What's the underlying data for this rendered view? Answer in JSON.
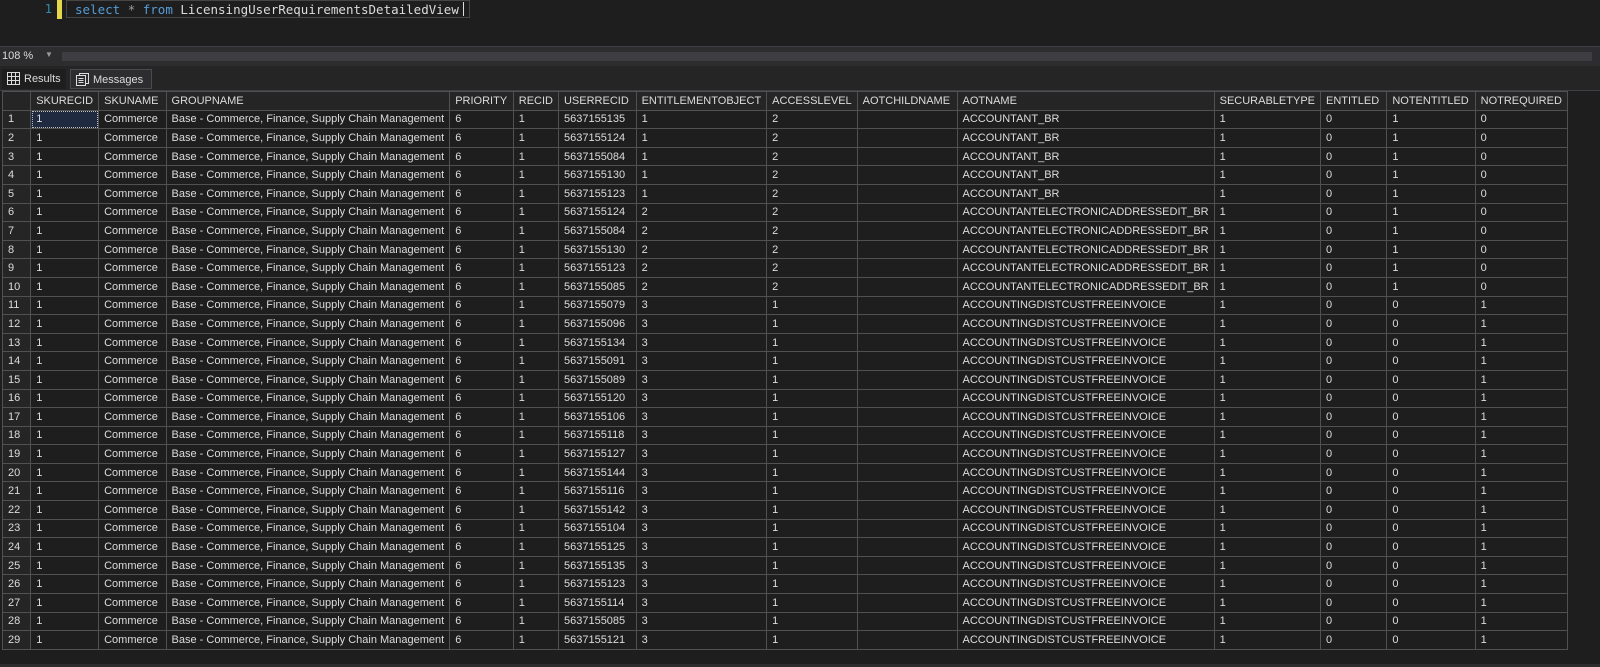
{
  "editor": {
    "line_number": "1",
    "keyword_select": "select",
    "star": "*",
    "keyword_from": "from",
    "table_name": "LicensingUserRequirementsDetailedView"
  },
  "zoom": {
    "value": "108 %"
  },
  "tabs": {
    "results": "Results",
    "messages": "Messages"
  },
  "grid": {
    "columns": [
      "",
      "SKURECID",
      "SKUNAME",
      "GROUPNAME",
      "PRIORITY",
      "RECID",
      "USERRECID",
      "ENTITLEMENTOBJECT",
      "ACCESSLEVEL",
      "AOTCHILDNAME",
      "AOTNAME",
      "SECURABLETYPE",
      "ENTITLED",
      "NOTENTITLED",
      "NOTREQUIRED"
    ],
    "rows": [
      [
        "1",
        "1",
        "Commerce",
        "Base - Commerce, Finance, Supply Chain Management",
        "6",
        "1",
        "5637155135",
        "1",
        "2",
        "",
        "ACCOUNTANT_BR",
        "1",
        "0",
        "1",
        "0"
      ],
      [
        "2",
        "1",
        "Commerce",
        "Base - Commerce, Finance, Supply Chain Management",
        "6",
        "1",
        "5637155124",
        "1",
        "2",
        "",
        "ACCOUNTANT_BR",
        "1",
        "0",
        "1",
        "0"
      ],
      [
        "3",
        "1",
        "Commerce",
        "Base - Commerce, Finance, Supply Chain Management",
        "6",
        "1",
        "5637155084",
        "1",
        "2",
        "",
        "ACCOUNTANT_BR",
        "1",
        "0",
        "1",
        "0"
      ],
      [
        "4",
        "1",
        "Commerce",
        "Base - Commerce, Finance, Supply Chain Management",
        "6",
        "1",
        "5637155130",
        "1",
        "2",
        "",
        "ACCOUNTANT_BR",
        "1",
        "0",
        "1",
        "0"
      ],
      [
        "5",
        "1",
        "Commerce",
        "Base - Commerce, Finance, Supply Chain Management",
        "6",
        "1",
        "5637155123",
        "1",
        "2",
        "",
        "ACCOUNTANT_BR",
        "1",
        "0",
        "1",
        "0"
      ],
      [
        "6",
        "1",
        "Commerce",
        "Base - Commerce, Finance, Supply Chain Management",
        "6",
        "1",
        "5637155124",
        "2",
        "2",
        "",
        "ACCOUNTANTELECTRONICADDRESSEDIT_BR",
        "1",
        "0",
        "1",
        "0"
      ],
      [
        "7",
        "1",
        "Commerce",
        "Base - Commerce, Finance, Supply Chain Management",
        "6",
        "1",
        "5637155084",
        "2",
        "2",
        "",
        "ACCOUNTANTELECTRONICADDRESSEDIT_BR",
        "1",
        "0",
        "1",
        "0"
      ],
      [
        "8",
        "1",
        "Commerce",
        "Base - Commerce, Finance, Supply Chain Management",
        "6",
        "1",
        "5637155130",
        "2",
        "2",
        "",
        "ACCOUNTANTELECTRONICADDRESSEDIT_BR",
        "1",
        "0",
        "1",
        "0"
      ],
      [
        "9",
        "1",
        "Commerce",
        "Base - Commerce, Finance, Supply Chain Management",
        "6",
        "1",
        "5637155123",
        "2",
        "2",
        "",
        "ACCOUNTANTELECTRONICADDRESSEDIT_BR",
        "1",
        "0",
        "1",
        "0"
      ],
      [
        "10",
        "1",
        "Commerce",
        "Base - Commerce, Finance, Supply Chain Management",
        "6",
        "1",
        "5637155085",
        "2",
        "2",
        "",
        "ACCOUNTANTELECTRONICADDRESSEDIT_BR",
        "1",
        "0",
        "1",
        "0"
      ],
      [
        "11",
        "1",
        "Commerce",
        "Base - Commerce, Finance, Supply Chain Management",
        "6",
        "1",
        "5637155079",
        "3",
        "1",
        "",
        "ACCOUNTINGDISTCUSTFREEINVOICE",
        "1",
        "0",
        "0",
        "1"
      ],
      [
        "12",
        "1",
        "Commerce",
        "Base - Commerce, Finance, Supply Chain Management",
        "6",
        "1",
        "5637155096",
        "3",
        "1",
        "",
        "ACCOUNTINGDISTCUSTFREEINVOICE",
        "1",
        "0",
        "0",
        "1"
      ],
      [
        "13",
        "1",
        "Commerce",
        "Base - Commerce, Finance, Supply Chain Management",
        "6",
        "1",
        "5637155134",
        "3",
        "1",
        "",
        "ACCOUNTINGDISTCUSTFREEINVOICE",
        "1",
        "0",
        "0",
        "1"
      ],
      [
        "14",
        "1",
        "Commerce",
        "Base - Commerce, Finance, Supply Chain Management",
        "6",
        "1",
        "5637155091",
        "3",
        "1",
        "",
        "ACCOUNTINGDISTCUSTFREEINVOICE",
        "1",
        "0",
        "0",
        "1"
      ],
      [
        "15",
        "1",
        "Commerce",
        "Base - Commerce, Finance, Supply Chain Management",
        "6",
        "1",
        "5637155089",
        "3",
        "1",
        "",
        "ACCOUNTINGDISTCUSTFREEINVOICE",
        "1",
        "0",
        "0",
        "1"
      ],
      [
        "16",
        "1",
        "Commerce",
        "Base - Commerce, Finance, Supply Chain Management",
        "6",
        "1",
        "5637155120",
        "3",
        "1",
        "",
        "ACCOUNTINGDISTCUSTFREEINVOICE",
        "1",
        "0",
        "0",
        "1"
      ],
      [
        "17",
        "1",
        "Commerce",
        "Base - Commerce, Finance, Supply Chain Management",
        "6",
        "1",
        "5637155106",
        "3",
        "1",
        "",
        "ACCOUNTINGDISTCUSTFREEINVOICE",
        "1",
        "0",
        "0",
        "1"
      ],
      [
        "18",
        "1",
        "Commerce",
        "Base - Commerce, Finance, Supply Chain Management",
        "6",
        "1",
        "5637155118",
        "3",
        "1",
        "",
        "ACCOUNTINGDISTCUSTFREEINVOICE",
        "1",
        "0",
        "0",
        "1"
      ],
      [
        "19",
        "1",
        "Commerce",
        "Base - Commerce, Finance, Supply Chain Management",
        "6",
        "1",
        "5637155127",
        "3",
        "1",
        "",
        "ACCOUNTINGDISTCUSTFREEINVOICE",
        "1",
        "0",
        "0",
        "1"
      ],
      [
        "20",
        "1",
        "Commerce",
        "Base - Commerce, Finance, Supply Chain Management",
        "6",
        "1",
        "5637155144",
        "3",
        "1",
        "",
        "ACCOUNTINGDISTCUSTFREEINVOICE",
        "1",
        "0",
        "0",
        "1"
      ],
      [
        "21",
        "1",
        "Commerce",
        "Base - Commerce, Finance, Supply Chain Management",
        "6",
        "1",
        "5637155116",
        "3",
        "1",
        "",
        "ACCOUNTINGDISTCUSTFREEINVOICE",
        "1",
        "0",
        "0",
        "1"
      ],
      [
        "22",
        "1",
        "Commerce",
        "Base - Commerce, Finance, Supply Chain Management",
        "6",
        "1",
        "5637155142",
        "3",
        "1",
        "",
        "ACCOUNTINGDISTCUSTFREEINVOICE",
        "1",
        "0",
        "0",
        "1"
      ],
      [
        "23",
        "1",
        "Commerce",
        "Base - Commerce, Finance, Supply Chain Management",
        "6",
        "1",
        "5637155104",
        "3",
        "1",
        "",
        "ACCOUNTINGDISTCUSTFREEINVOICE",
        "1",
        "0",
        "0",
        "1"
      ],
      [
        "24",
        "1",
        "Commerce",
        "Base - Commerce, Finance, Supply Chain Management",
        "6",
        "1",
        "5637155125",
        "3",
        "1",
        "",
        "ACCOUNTINGDISTCUSTFREEINVOICE",
        "1",
        "0",
        "0",
        "1"
      ],
      [
        "25",
        "1",
        "Commerce",
        "Base - Commerce, Finance, Supply Chain Management",
        "6",
        "1",
        "5637155135",
        "3",
        "1",
        "",
        "ACCOUNTINGDISTCUSTFREEINVOICE",
        "1",
        "0",
        "0",
        "1"
      ],
      [
        "26",
        "1",
        "Commerce",
        "Base - Commerce, Finance, Supply Chain Management",
        "6",
        "1",
        "5637155123",
        "3",
        "1",
        "",
        "ACCOUNTINGDISTCUSTFREEINVOICE",
        "1",
        "0",
        "0",
        "1"
      ],
      [
        "27",
        "1",
        "Commerce",
        "Base - Commerce, Finance, Supply Chain Management",
        "6",
        "1",
        "5637155114",
        "3",
        "1",
        "",
        "ACCOUNTINGDISTCUSTFREEINVOICE",
        "1",
        "0",
        "0",
        "1"
      ],
      [
        "28",
        "1",
        "Commerce",
        "Base - Commerce, Finance, Supply Chain Management",
        "6",
        "1",
        "5637155085",
        "3",
        "1",
        "",
        "ACCOUNTINGDISTCUSTFREEINVOICE",
        "1",
        "0",
        "0",
        "1"
      ],
      [
        "29",
        "1",
        "Commerce",
        "Base - Commerce, Finance, Supply Chain Management",
        "6",
        "1",
        "5637155121",
        "3",
        "1",
        "",
        "ACCOUNTINGDISTCUSTFREEINVOICE",
        "1",
        "0",
        "0",
        "1"
      ]
    ]
  },
  "icons": {
    "results": "grid-icon",
    "messages": "messages-icon"
  },
  "colors": {
    "keyword": "#569cd6",
    "gutter_marker": "#e3d74a",
    "line_number": "#2b91af"
  }
}
